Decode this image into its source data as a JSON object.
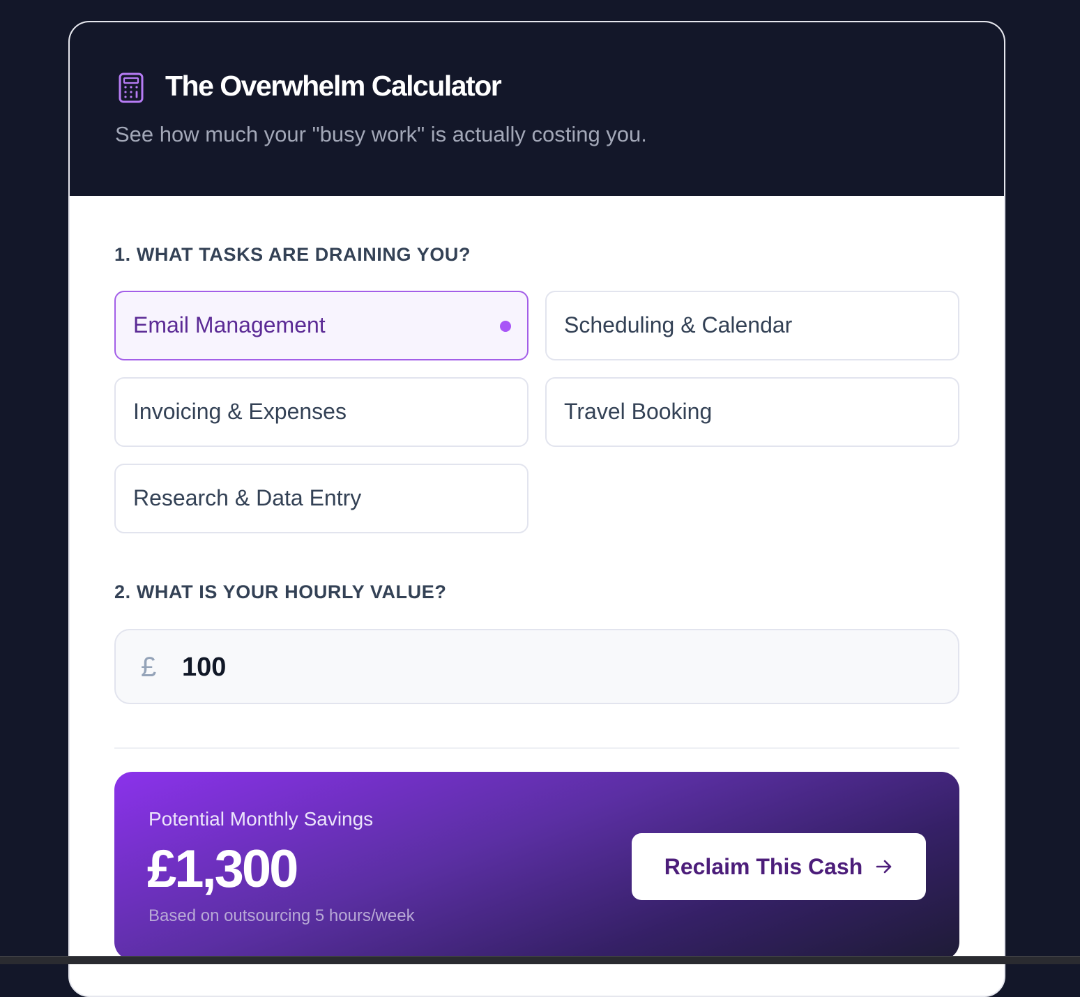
{
  "header": {
    "icon": "calculator-icon",
    "title": "The Overwhelm Calculator",
    "subtitle": "See how much your \"busy work\" is actually costing you."
  },
  "tasks_section": {
    "label": "1. WHAT TASKS ARE DRAINING YOU?",
    "items": [
      {
        "label": "Email Management",
        "selected": true
      },
      {
        "label": "Scheduling & Calendar",
        "selected": false
      },
      {
        "label": "Invoicing & Expenses",
        "selected": false
      },
      {
        "label": "Travel Booking",
        "selected": false
      },
      {
        "label": "Research & Data Entry",
        "selected": false
      }
    ]
  },
  "hourly_section": {
    "label": "2. WHAT IS YOUR HOURLY VALUE?",
    "currency_symbol": "£",
    "value": "100"
  },
  "savings": {
    "label": "Potential Monthly Savings",
    "amount": "£1,300",
    "note": "Based on outsourcing 5 hours/week",
    "cta_label": "Reclaim This Cash",
    "cta_icon": "arrow-right-icon"
  },
  "colors": {
    "background": "#131729",
    "accent": "#a855f7",
    "accent_dark": "#4c1d7a",
    "selected_bg": "#f8f4fe"
  }
}
